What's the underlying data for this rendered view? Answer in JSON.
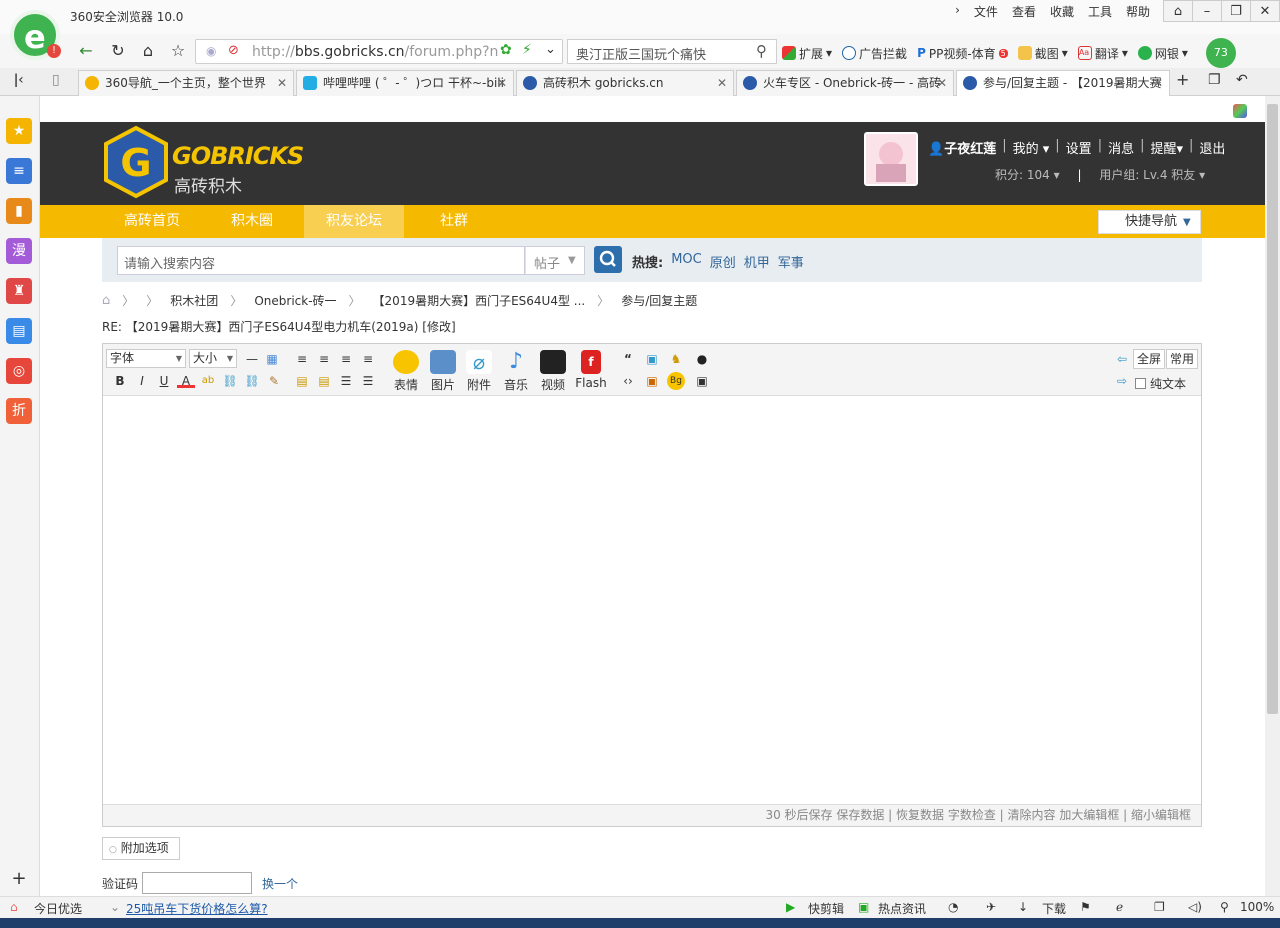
{
  "browser": {
    "app_title": "360安全浏览器 10.0",
    "menu": [
      "文件",
      "查看",
      "收藏",
      "工具",
      "帮助"
    ],
    "url_host": "bbs.gobricks.cn",
    "url_prefix": "http://",
    "url_path": "/forum.php?n",
    "search_text": "奥汀正版三国玩个痛快",
    "badge_count": "73",
    "toolbar": {
      "ext": "扩展",
      "adblock": "广告拦截",
      "pp": "PP视频-体育",
      "pp_badge": "5",
      "screenshot": "截图",
      "translate": "翻译",
      "bank": "网银"
    },
    "tabs": [
      {
        "label": "360导航_一个主页，整个世界",
        "active": false,
        "color": "#f5b400"
      },
      {
        "label": "哔哩哔哩 ( ゜- ゜)つロ 干杯~-bili",
        "active": false,
        "color": "#23ade5"
      },
      {
        "label": "高砖积木 gobricks.cn",
        "active": false,
        "color": "#2a5aa8"
      },
      {
        "label": "火车专区 - Onebrick-砖一 - 高砖",
        "active": false,
        "color": "#2a5aa8"
      },
      {
        "label": "参与/回复主题 - 【2019暑期大赛",
        "active": true,
        "color": "#2a5aa8"
      }
    ]
  },
  "site": {
    "logo_en": "GOBRICKS",
    "logo_cn": "高砖积木",
    "user": {
      "name": "子夜红莲",
      "links": [
        "我的",
        "设置",
        "消息",
        "提醒",
        "退出"
      ],
      "points": "积分: 104",
      "group": "用户组: Lv.4 积友"
    },
    "nav": [
      "高砖首页",
      "积木圈",
      "积友论坛",
      "社群"
    ],
    "active_nav": 2,
    "quick_nav": "快捷导航",
    "search": {
      "placeholder": "请输入搜索内容",
      "type": "帖子",
      "hot_label": "热搜:",
      "hot": [
        "MOC",
        "原创",
        "机甲",
        "军事"
      ]
    },
    "breadcrumb": [
      "积木社团",
      "Onebrick-砖一",
      "【2019暑期大赛】西门子ES64U4型 ...",
      "参与/回复主题"
    ],
    "reply_title": "RE: 【2019暑期大赛】西门子ES64U4型电力机车(2019a) [修改]",
    "editor": {
      "font": "字体",
      "size": "大小",
      "big_buttons": [
        "表情",
        "图片",
        "附件",
        "音乐",
        "视频",
        "Flash"
      ],
      "fullscreen": "全屏",
      "common": "常用",
      "plain": "纯文本",
      "status": "30 秒后保存 保存数据 | 恢复数据    字数检查 | 清除内容    加大编辑框 | 缩小编辑框"
    },
    "add_options": "附加选项",
    "captcha_label": "验证码",
    "captcha_change": "换一个"
  },
  "statusbar": {
    "today": "今日优选",
    "news": "25吨吊车下货价格怎么算?",
    "clip": "快剪辑",
    "hot": "热点资讯",
    "download": "下载",
    "zoom": "100%"
  }
}
